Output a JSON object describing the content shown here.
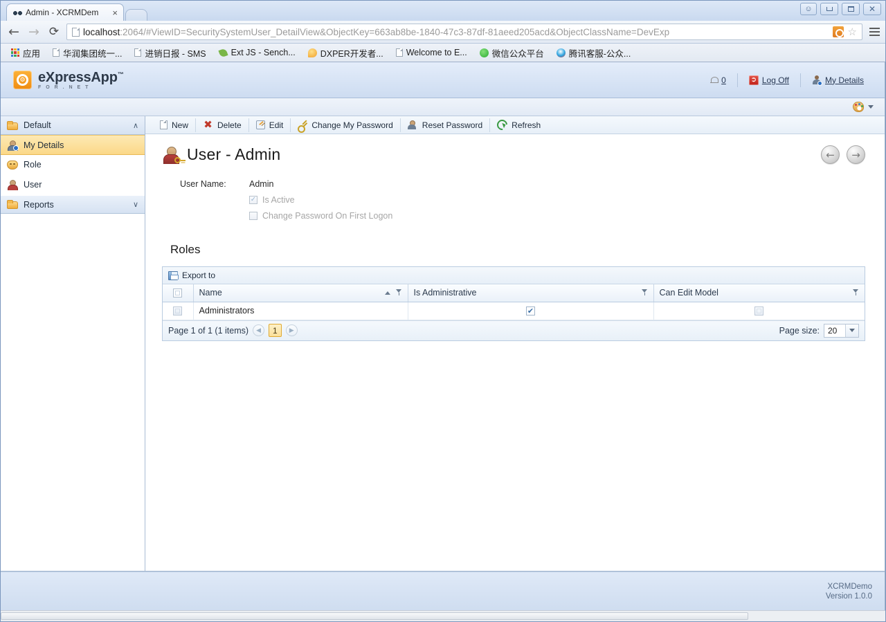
{
  "browser": {
    "tab": {
      "title": "Admin - XCRMDem",
      "close_label": "×"
    },
    "url": "localhost:2064/#ViewID=SecuritySystemUser_DetailView&ObjectKey=663ab8be-1840-47c3-87df-81aeed205acd&ObjectClassName=DevExp",
    "url_host": "localhost",
    "back_glyph": "←",
    "forward_glyph": "→",
    "reload_glyph": "⟳",
    "star_glyph": "☆",
    "bookmarks": [
      {
        "label": "应用",
        "icon": "apps-grid-icon"
      },
      {
        "label": "华润集团统一...",
        "icon": "document-icon"
      },
      {
        "label": "进销日报 - SMS",
        "icon": "document-icon"
      },
      {
        "label": "Ext JS - Sench...",
        "icon": "leaf-icon"
      },
      {
        "label": "DXPER开发者...",
        "icon": "orange-icon"
      },
      {
        "label": "Welcome to E...",
        "icon": "document-icon"
      },
      {
        "label": "微信公众平台",
        "icon": "wechat-icon"
      },
      {
        "label": "腾讯客服-公众...",
        "icon": "tencent-icon"
      }
    ]
  },
  "app": {
    "logo_name": "eXpressApp",
    "logo_tm": "™",
    "logo_sub": "F O R . N E T",
    "header_links": [
      {
        "label": "0",
        "icon": "bell-icon",
        "name": "notifications-link"
      },
      {
        "label": "Log Off",
        "icon": "logoff-icon",
        "name": "log-off-link"
      },
      {
        "label": "My Details",
        "icon": "person-badge-icon",
        "name": "my-details-link"
      }
    ]
  },
  "sidebar": {
    "groups": [
      {
        "label": "Default",
        "expanded": true,
        "chevron": "∧"
      },
      {
        "label": "Reports",
        "expanded": false,
        "chevron": "∨"
      }
    ],
    "items": [
      {
        "label": "My Details",
        "icon": "person-badge-icon",
        "selected": true
      },
      {
        "label": "Role",
        "icon": "mask-icon",
        "selected": false
      },
      {
        "label": "User",
        "icon": "user-icon",
        "selected": false
      }
    ]
  },
  "toolbar": {
    "buttons": [
      {
        "label": "New",
        "icon": "new-document-icon"
      },
      {
        "label": "Delete",
        "icon": "delete-x-icon"
      },
      {
        "label": "Edit",
        "icon": "edit-pencil-icon"
      },
      {
        "label": "Change My Password",
        "icon": "key-icon"
      },
      {
        "label": "Reset Password",
        "icon": "reset-user-icon"
      },
      {
        "label": "Refresh",
        "icon": "refresh-icon"
      }
    ]
  },
  "detail": {
    "title": "User - Admin",
    "prev_glyph": "←",
    "next_glyph": "→",
    "fields": [
      {
        "label": "User Name:",
        "value": "Admin"
      }
    ],
    "checkboxes": [
      {
        "label": "Is Active",
        "checked": true,
        "glyph": "✓"
      },
      {
        "label": "Change Password On First Logon",
        "checked": false,
        "glyph": ""
      }
    ]
  },
  "roles": {
    "section_title": "Roles",
    "export_label": "Export to",
    "columns": [
      {
        "label": "Name",
        "sorted": "asc",
        "filter": true
      },
      {
        "label": "Is Administrative",
        "sorted": "",
        "filter": true
      },
      {
        "label": "Can Edit Model",
        "sorted": "",
        "filter": true
      }
    ],
    "rows": [
      {
        "name": "Administrators",
        "is_administrative": true,
        "can_edit_model": false
      }
    ],
    "checked_glyph": "✔",
    "pager": {
      "summary": "Page 1 of 1 (1 items)",
      "prev_glyph": "◀",
      "next_glyph": "▶",
      "current_page": "1",
      "page_size_label": "Page size:",
      "page_size_value": "20"
    }
  },
  "footer": {
    "app_name": "XCRMDemo",
    "version": "Version 1.0.0"
  }
}
